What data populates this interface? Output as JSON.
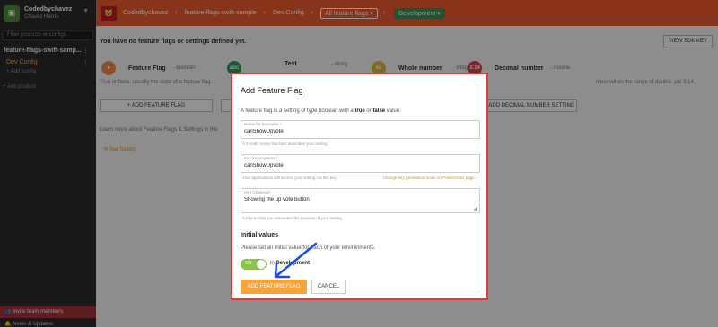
{
  "sidebar": {
    "account_name": "Codedbychavez",
    "account_sub": "Chavez Harris",
    "filter_placeholder": "Filter products or configs",
    "product_name": "feature-flags-swift-samp...",
    "config_name": "Dev Config",
    "add_config": "+ Add config",
    "add_product": "+ Add product",
    "invite": "Invite team members",
    "news": "News & Updates"
  },
  "topbar": {
    "account": "Codedbychavez",
    "product": "feature-flags-swift-sample",
    "config": "Dev Config",
    "filter": "All feature flags",
    "environment": "Development"
  },
  "main": {
    "no_flags": "You have no feature flags or settings defined yet.",
    "view_sdk_key": "VIEW SDK KEY",
    "types": [
      {
        "name": "Feature Flag",
        "kind": "- boolean",
        "icon_text": "",
        "color": "#f08a4b"
      },
      {
        "name": "Text",
        "kind": "- string",
        "icon_text": "abc",
        "color": "#2e9b57"
      },
      {
        "name": "Whole number",
        "kind": "- integer",
        "icon_text": "42",
        "color": "#e0b33a"
      },
      {
        "name": "Decimal number",
        "kind": "- double",
        "icon_text": "3.14",
        "color": "#d6414a"
      }
    ],
    "flag_desc": "True or false, usually the state of a feature flag.",
    "decimal_desc": "mber within the range of double. ple 3.14.",
    "add_feature_flag": "+ ADD FEATURE FLAG",
    "add_decimal": "+ ADD DECIMAL NUMBER SETTING",
    "learn_more": "Learn more about Feature Flags & Settings in the",
    "see_history": "See history"
  },
  "modal": {
    "title": "Add Feature Flag",
    "desc_prefix": "A feature flag is a setting of type boolean with a ",
    "desc_true": "true",
    "desc_or": " or ",
    "desc_false": "false",
    "desc_suffix": " value.",
    "name_label": "Name for hoomans *",
    "name_value": "canShowUpvote",
    "name_help": "A friendly name that best describes your setting.",
    "key_label": "Key for programs *",
    "key_value": "canShowUpvote",
    "key_help": "Your applications will access your setting via this key.",
    "key_mode": "Change key generation mode on Preferences page.",
    "hint_label": "Hint (Optional)",
    "hint_value": "Showing the up vote button",
    "hint_help": "A hint to help you remember the purpose of your setting.",
    "initial_title": "Initial values",
    "initial_desc": "Please set an initial value for each of your environments.",
    "toggle_label": "ON",
    "toggle_in": "in ",
    "toggle_env": "Development",
    "add_button": "ADD FEATURE FLAG",
    "cancel_button": "CANCEL"
  },
  "colors": {
    "accent": "#e95b2d",
    "modal_border": "#e53935",
    "primary_button": "#f6a43a",
    "toggle_on": "#8bc34a",
    "annotation_arrow": "#1a4fe0"
  }
}
